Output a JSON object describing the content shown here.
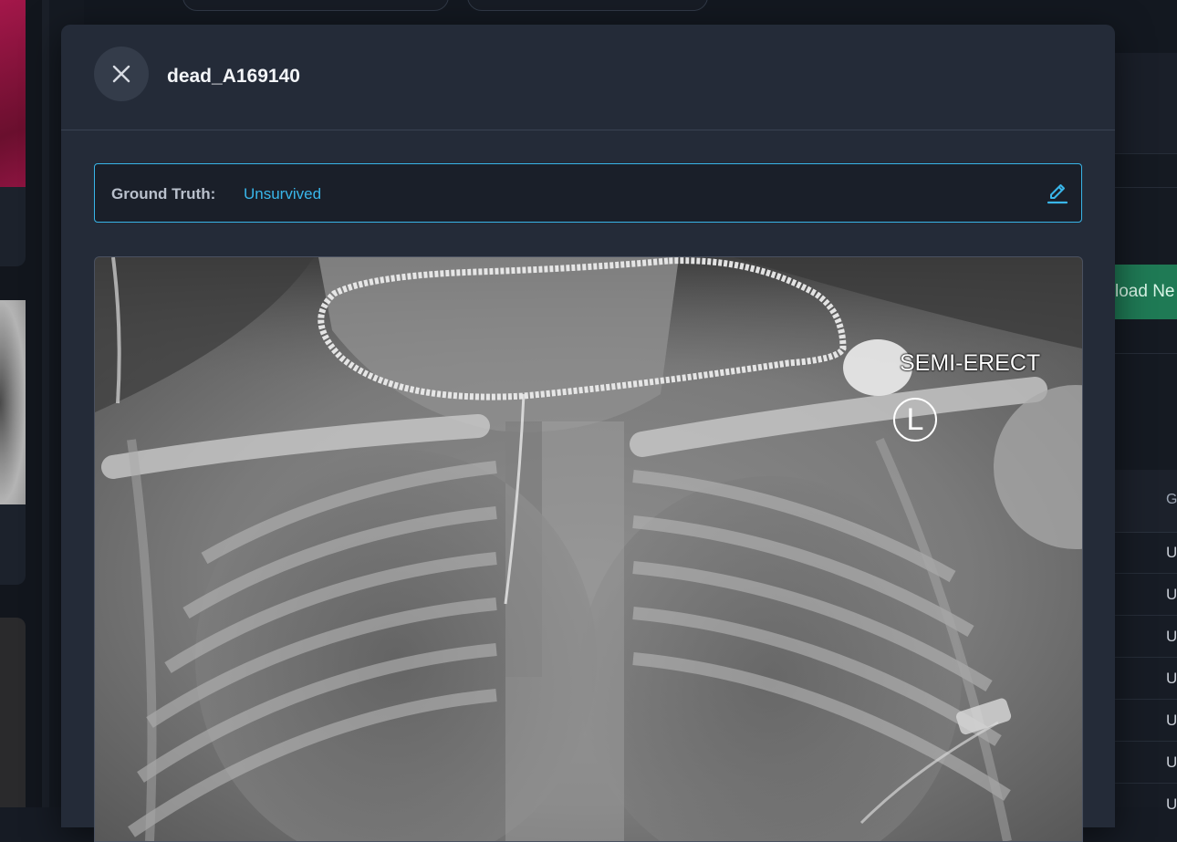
{
  "modal": {
    "title": "dead_A169140",
    "close_icon": "close-icon",
    "ground_truth": {
      "label": "Ground Truth:",
      "value": "Unsurvived",
      "edit_icon": "pencil-icon"
    },
    "image": {
      "overlay_text": "SEMI-ERECT",
      "side_marker": "L"
    }
  },
  "background": {
    "upload_button_label": "load Ne",
    "table_header_fragment": "G",
    "table_cells": [
      "U",
      "U",
      "U",
      "U",
      "U",
      "U",
      "U"
    ]
  },
  "colors": {
    "accent": "#38b5e8",
    "modal_bg": "#242b38",
    "upload_green": "#1f7a55"
  }
}
